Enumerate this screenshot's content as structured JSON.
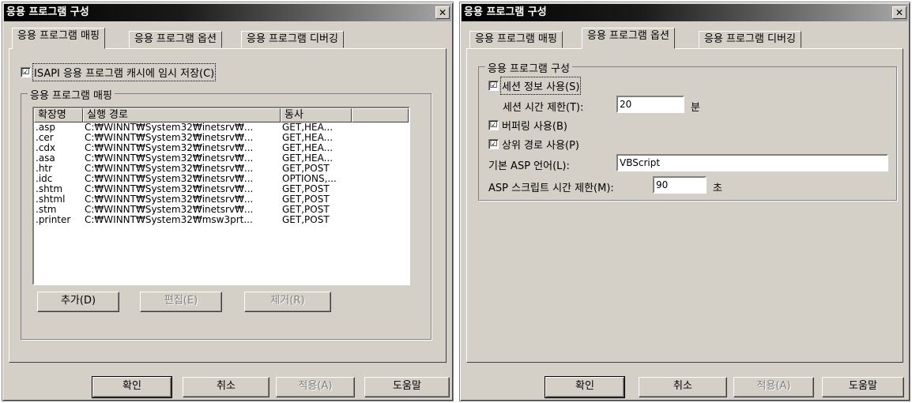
{
  "left_dialog": {
    "title": "응용 프로그램 구성",
    "close_glyph": "✕",
    "tabs": [
      "응용 프로그램 매핑",
      "응용 프로그램 옵션",
      "응용 프로그램 디버깅"
    ],
    "cache_checkbox": {
      "label": "ISAPI 응용 프로그램 캐시에 임시 저장(C)",
      "checked": "☑"
    },
    "mapping_group_title": "응용 프로그램 매핑",
    "columns": [
      "확장명",
      "실행 경로",
      "동사"
    ],
    "rows": [
      [
        ".asp",
        "C:₩WINNT₩System32₩inetsrv₩...",
        "GET,HEA..."
      ],
      [
        ".cer",
        "C:₩WINNT₩System32₩inetsrv₩...",
        "GET,HEA..."
      ],
      [
        ".cdx",
        "C:₩WINNT₩System32₩inetsrv₩...",
        "GET,HEA..."
      ],
      [
        ".asa",
        "C:₩WINNT₩System32₩inetsrv₩...",
        "GET,HEA..."
      ],
      [
        ".htr",
        "C:₩WINNT₩System32₩inetsrv₩...",
        "GET,POST"
      ],
      [
        ".idc",
        "C:₩WINNT₩System32₩inetsrv₩...",
        "OPTIONS,..."
      ],
      [
        ".shtm",
        "C:₩WINNT₩System32₩inetsrv₩...",
        "GET,POST"
      ],
      [
        ".shtml",
        "C:₩WINNT₩System32₩inetsrv₩...",
        "GET,POST"
      ],
      [
        ".stm",
        "C:₩WINNT₩System32₩inetsrv₩...",
        "GET,POST"
      ],
      [
        ".printer",
        "C:₩WINNT₩System32₩msw3prt...",
        "GET,POST"
      ]
    ],
    "add_button": "추가(D)",
    "edit_button": "편집(E)",
    "remove_button": "제거(R)",
    "ok_button": "확인",
    "cancel_button": "취소",
    "apply_button": "적용(A)",
    "help_button": "도움말"
  },
  "right_dialog": {
    "title": "응용 프로그램 구성",
    "close_glyph": "✕",
    "tabs": [
      "응용 프로그램 매핑",
      "응용 프로그램 옵션",
      "응용 프로그램 디버깅"
    ],
    "group_title": "응용 프로그램 구성",
    "session_state": {
      "label": "세션 정보 사용(S)",
      "checked": "☑"
    },
    "session_timeout": {
      "label": "세션 시간 제한(T):",
      "value": "20",
      "unit": "분"
    },
    "buffering": {
      "label": "버퍼링 사용(B)",
      "checked": "☑"
    },
    "parent_paths": {
      "label": "상위 경로 사용(P)",
      "checked": "☑"
    },
    "default_language": {
      "label": "기본 ASP 언어(L):",
      "value": "VBScript"
    },
    "script_timeout": {
      "label": "ASP 스크립트 시간 제한(M):",
      "value": "90",
      "unit": "초"
    },
    "ok_button": "확인",
    "cancel_button": "취소",
    "apply_button": "적용(A)",
    "help_button": "도움말"
  }
}
